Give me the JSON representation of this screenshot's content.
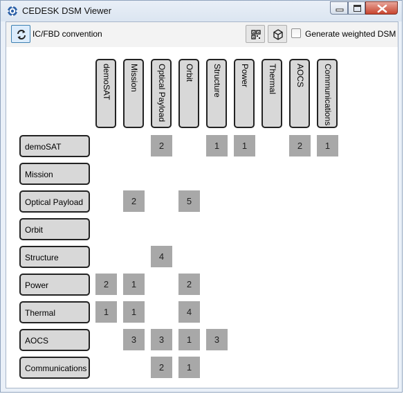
{
  "window": {
    "title": "CEDESK DSM Viewer",
    "icon": "cedesk-app-icon",
    "buttons": [
      "minimize",
      "maximize",
      "close"
    ]
  },
  "toolbar": {
    "refresh_icon": "refresh-icon",
    "convention_label": "IC/FBD convention",
    "qr_icon": "qr-code-icon",
    "cube_icon": "cube-icon",
    "weighted_label": "Generate weighted DSM",
    "weighted_checked": false
  },
  "dsm": {
    "elements": [
      "demoSAT",
      "Mission",
      "Optical Payload",
      "Orbit",
      "Structure",
      "Power",
      "Thermal",
      "AOCS",
      "Communications"
    ],
    "cells": [
      {
        "row": 0,
        "col": 2,
        "value": "2"
      },
      {
        "row": 0,
        "col": 4,
        "value": "1"
      },
      {
        "row": 0,
        "col": 5,
        "value": "1"
      },
      {
        "row": 0,
        "col": 7,
        "value": "2"
      },
      {
        "row": 0,
        "col": 8,
        "value": "1"
      },
      {
        "row": 2,
        "col": 1,
        "value": "2"
      },
      {
        "row": 2,
        "col": 3,
        "value": "5"
      },
      {
        "row": 4,
        "col": 2,
        "value": "4"
      },
      {
        "row": 5,
        "col": 0,
        "value": "2"
      },
      {
        "row": 5,
        "col": 1,
        "value": "1"
      },
      {
        "row": 5,
        "col": 3,
        "value": "2"
      },
      {
        "row": 6,
        "col": 0,
        "value": "1"
      },
      {
        "row": 6,
        "col": 1,
        "value": "1"
      },
      {
        "row": 6,
        "col": 3,
        "value": "4"
      },
      {
        "row": 7,
        "col": 1,
        "value": "3"
      },
      {
        "row": 7,
        "col": 2,
        "value": "3"
      },
      {
        "row": 7,
        "col": 3,
        "value": "1"
      },
      {
        "row": 7,
        "col": 4,
        "value": "3"
      },
      {
        "row": 8,
        "col": 2,
        "value": "2"
      },
      {
        "row": 8,
        "col": 3,
        "value": "1"
      }
    ],
    "cell_color": "#a8a8a8",
    "header_color": "#d8d8d8"
  }
}
